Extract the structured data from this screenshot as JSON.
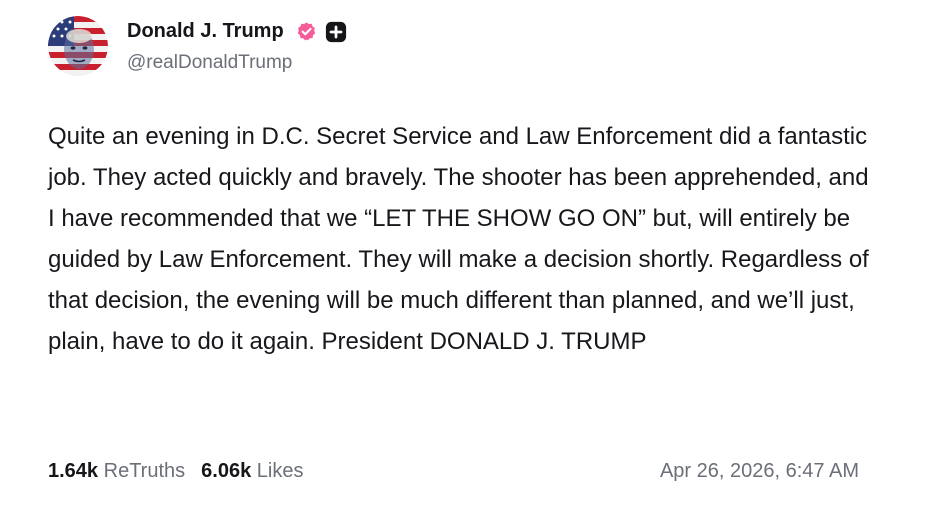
{
  "post": {
    "display_name": "Donald J. Trump",
    "handle": "@realDonaldTrump",
    "verified_icon": "verified-badge-icon",
    "plus_icon": "plus-badge-icon",
    "text": "Quite an evening in D.C. Secret Service and Law Enforcement did a fantastic job. They acted quickly and bravely. The shooter has been apprehended, and I have recommended that we “LET THE SHOW GO ON” but, will entirely be guided by Law Enforcement. They will make a decision shortly. Regardless of that decision, the evening will be much different than planned, and we’ll just, plain, have to do it again. President DONALD J. TRUMP",
    "retruths_count": "1.64k",
    "retruths_label": "ReTruths",
    "likes_count": "6.06k",
    "likes_label": "Likes",
    "timestamp": "Apr 26, 2026, 6:47 AM"
  },
  "colors": {
    "verified": "#f55c99",
    "plus": "#15151a",
    "muted_text": "#6b6f78"
  }
}
